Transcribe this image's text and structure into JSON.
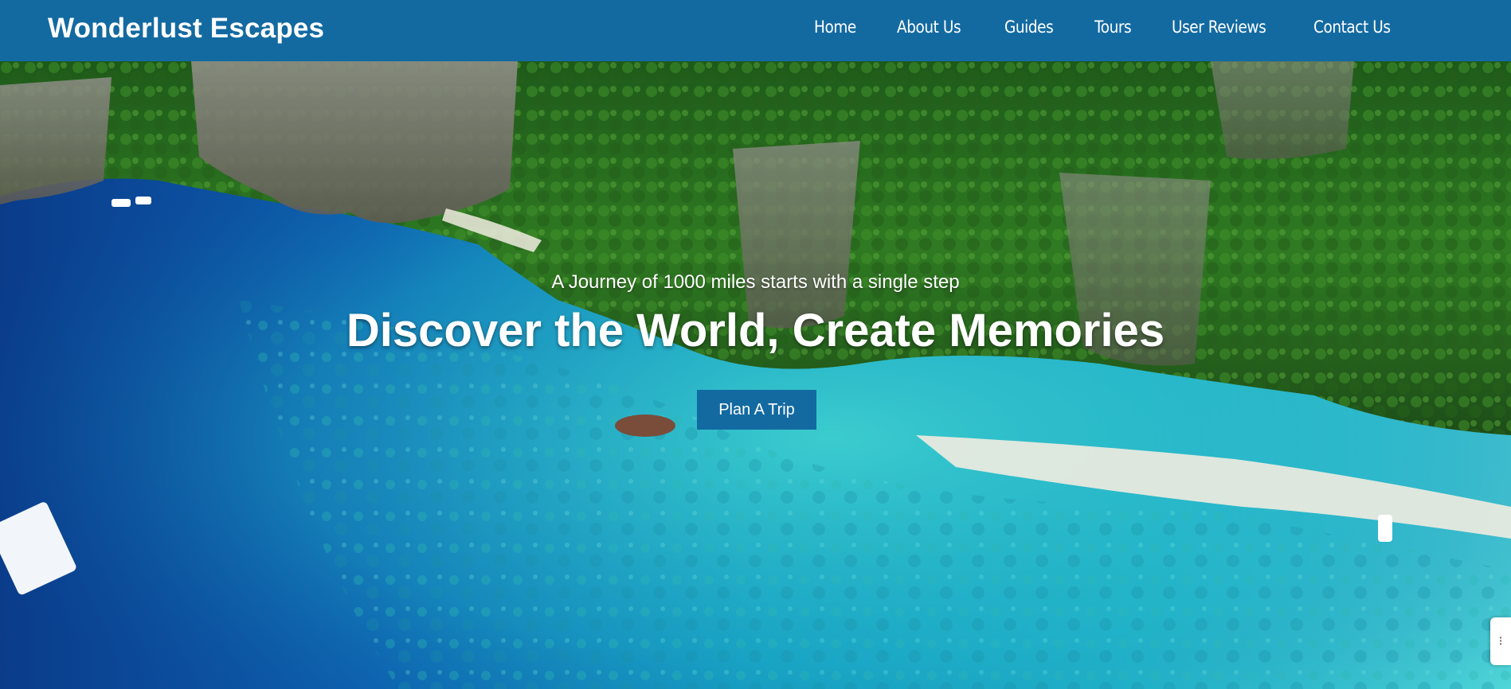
{
  "brand": {
    "name": "Wonderlust Escapes"
  },
  "nav": {
    "items": [
      {
        "label": "Home"
      },
      {
        "label": "About Us"
      },
      {
        "label": "Guides"
      },
      {
        "label": "Tours"
      },
      {
        "label": "User Reviews"
      },
      {
        "label": "Contact Us"
      }
    ]
  },
  "hero": {
    "tagline": "A Journey of 1000 miles starts with a single step",
    "headline": "Discover the World, Create Memories",
    "cta_label": "Plan A Trip",
    "background": "aerial-tropical-island-photo"
  },
  "side_widget": {
    "icon": "drag-handle-icon"
  },
  "colors": {
    "navbar": "#136aa1",
    "button": "#136aa1",
    "text": "#ffffff"
  }
}
